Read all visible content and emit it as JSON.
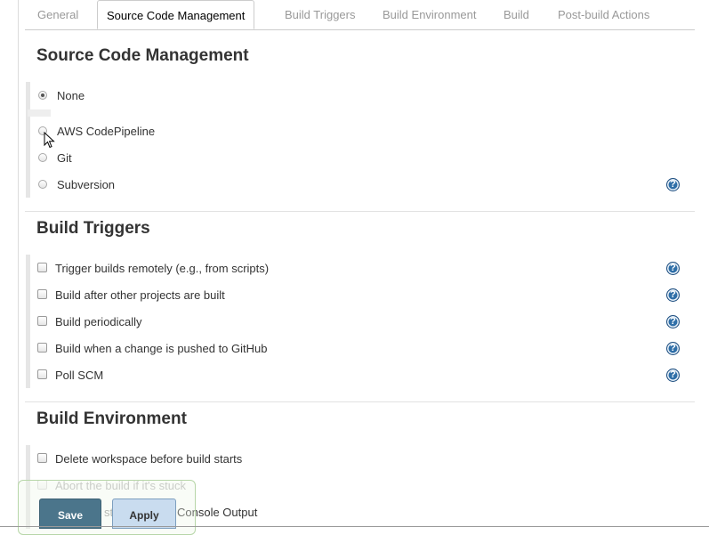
{
  "tabs": [
    {
      "label": "General"
    },
    {
      "label": "Source Code Management"
    },
    {
      "label": "Build Triggers"
    },
    {
      "label": "Build Environment"
    },
    {
      "label": "Build"
    },
    {
      "label": "Post-build Actions"
    }
  ],
  "active_tab": "Source Code Management",
  "scm": {
    "title": "Source Code Management",
    "selected": "None",
    "options": [
      {
        "label": "None",
        "checked": true
      },
      {
        "label": "AWS CodePipeline",
        "checked": false
      },
      {
        "label": "Git",
        "checked": false
      },
      {
        "label": "Subversion",
        "checked": false
      }
    ]
  },
  "triggers": {
    "title": "Build Triggers",
    "options": [
      {
        "label": "Trigger builds remotely (e.g., from scripts)",
        "checked": false
      },
      {
        "label": "Build after other projects are built",
        "checked": false
      },
      {
        "label": "Build periodically",
        "checked": false
      },
      {
        "label": "Build when a change is pushed to GitHub",
        "checked": false
      },
      {
        "label": "Poll SCM",
        "checked": false
      }
    ]
  },
  "environment": {
    "title": "Build Environment",
    "options": [
      {
        "label": "Delete workspace before build starts",
        "checked": false
      },
      {
        "label": "Abort the build if it's stuck",
        "checked": false
      },
      {
        "label_partial_left": "st",
        "label_partial_right": "Console Output",
        "checked": false
      }
    ]
  },
  "help_glyph": "?",
  "buttons": {
    "save": "Save",
    "apply": "Apply"
  },
  "icons": {
    "help": "help-icon",
    "cursor": "mouse-pointer-icon"
  },
  "colors": {
    "help": "#2f6fa8",
    "save": "#4b758b",
    "apply": "#c9dcef"
  }
}
